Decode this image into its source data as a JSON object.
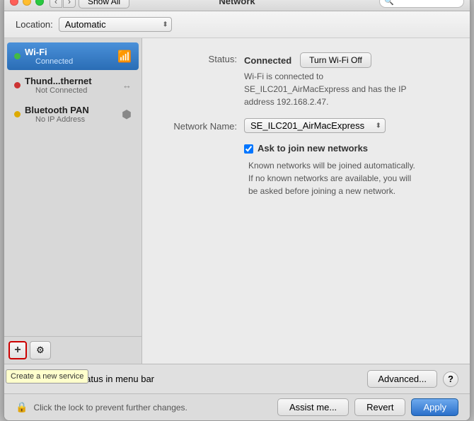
{
  "window": {
    "title": "Network"
  },
  "toolbar": {
    "location_label": "Location:",
    "location_value": "Automatic",
    "search_placeholder": ""
  },
  "sidebar": {
    "networks": [
      {
        "id": "wifi",
        "name": "Wi-Fi",
        "status": "Connected",
        "dot_color": "green",
        "selected": true,
        "icon": "wifi"
      },
      {
        "id": "thunderbolt",
        "name": "Thund...thernet",
        "status": "Not Connected",
        "dot_color": "red",
        "selected": false,
        "icon": "ethernet"
      },
      {
        "id": "bluetooth",
        "name": "Bluetooth PAN",
        "status": "No IP Address",
        "dot_color": "yellow",
        "selected": false,
        "icon": "bluetooth"
      }
    ],
    "add_button": "+",
    "gear_button": "⚙",
    "tooltip": "Create a new service"
  },
  "main": {
    "status_label": "Status:",
    "status_value": "Connected",
    "turn_off_label": "Turn Wi-Fi Off",
    "status_desc": "Wi-Fi is connected to\nSE_ILC201_AirMacExpress and has the IP\naddress 192.168.2.47.",
    "network_name_label": "Network Name:",
    "network_name_value": "SE_ILC201_AirMacExpress",
    "checkbox_label": "Ask to join new networks",
    "checkbox_desc": "Known networks will be joined automatically.\nIf no known networks are available, you will\nbe asked before joining a new network."
  },
  "bottom": {
    "show_wifi_checkbox_label": "Show Wi-Fi status in menu bar",
    "advanced_btn": "Advanced...",
    "help_btn": "?",
    "assist_btn": "Assist me...",
    "revert_btn": "Revert",
    "apply_btn": "Apply"
  },
  "lock_bar": {
    "icon": "🔒",
    "text": "Click the lock to prevent further changes."
  }
}
